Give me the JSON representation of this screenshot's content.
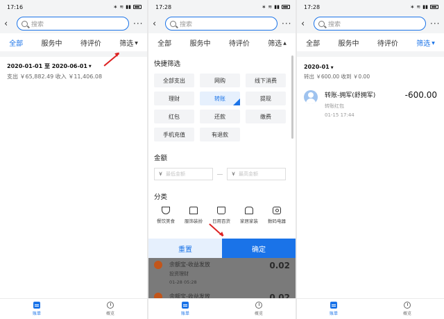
{
  "screens": [
    {
      "status": {
        "time": "17:16",
        "battery": "100"
      },
      "search_placeholder": "搜索",
      "tabs": [
        {
          "label": "全部",
          "active": true
        },
        {
          "label": "服务中",
          "active": false
        },
        {
          "label": "待评价",
          "active": false
        },
        {
          "label": "筛选",
          "active": false
        }
      ],
      "range": "2020-01-01 至 2020-06-01",
      "totals": "支出 ￥65,882.49   收入 ￥11,406.08",
      "nav": [
        {
          "label": "账单",
          "active": true
        },
        {
          "label": "概览",
          "active": false
        }
      ]
    },
    {
      "status": {
        "time": "17:28",
        "battery": "100"
      },
      "search_placeholder": "搜索",
      "tabs": [
        {
          "label": "全部",
          "active": false
        },
        {
          "label": "服务中",
          "active": false
        },
        {
          "label": "待评价",
          "active": false
        },
        {
          "label": "筛选",
          "active": false
        }
      ],
      "quick_title": "快捷筛选",
      "quick": [
        {
          "label": "全部支出",
          "selected": false
        },
        {
          "label": "网购",
          "selected": false
        },
        {
          "label": "线下消费",
          "selected": false
        },
        {
          "label": "理财",
          "selected": false
        },
        {
          "label": "转账",
          "selected": true
        },
        {
          "label": "提现",
          "selected": false
        },
        {
          "label": "红包",
          "selected": false
        },
        {
          "label": "还款",
          "selected": false
        },
        {
          "label": "缴费",
          "selected": false
        },
        {
          "label": "手机充值",
          "selected": false
        },
        {
          "label": "有退款",
          "selected": false
        }
      ],
      "amount_title": "金额",
      "amount_min": {
        "currency": "￥",
        "placeholder": "最低金额"
      },
      "amount_max": {
        "currency": "￥",
        "placeholder": "最高金额"
      },
      "category_title": "分类",
      "categories": [
        {
          "label": "餐饮美食",
          "icon": "bowl-icon"
        },
        {
          "label": "服饰装扮",
          "icon": "shirt-icon"
        },
        {
          "label": "日用百货",
          "icon": "bag-icon"
        },
        {
          "label": "家居家装",
          "icon": "sofa-icon"
        },
        {
          "label": "数码电器",
          "icon": "camera-icon"
        }
      ],
      "reset_label": "重置",
      "confirm_label": "确定",
      "behind": [
        {
          "title": "余额宝-收益发放",
          "sub": "投资理财",
          "date": "01-28  05:28",
          "amount": "0.02"
        },
        {
          "title": "余额宝-收益发放",
          "amount": "0.02"
        }
      ],
      "nav": [
        {
          "label": "账单",
          "active": true
        },
        {
          "label": "概览",
          "active": false
        }
      ]
    },
    {
      "status": {
        "time": "17:28",
        "battery": "100"
      },
      "search_placeholder": "搜索",
      "tabs": [
        {
          "label": "全部",
          "active": false
        },
        {
          "label": "服务中",
          "active": false
        },
        {
          "label": "待评价",
          "active": false
        },
        {
          "label": "筛选",
          "active": true
        }
      ],
      "month": "2020-01",
      "month_totals": "转出 ￥600.00   收到 ￥0.00",
      "txn": {
        "title": "转账-拥军(舒拥军)",
        "sub": "转账红包",
        "date": "01-15  17:44",
        "amount": "-600.00"
      },
      "nav": [
        {
          "label": "账单",
          "active": true
        },
        {
          "label": "概览",
          "active": false
        }
      ]
    }
  ],
  "colors": {
    "accent": "#1a73e8",
    "arrow": "#dd2222"
  }
}
